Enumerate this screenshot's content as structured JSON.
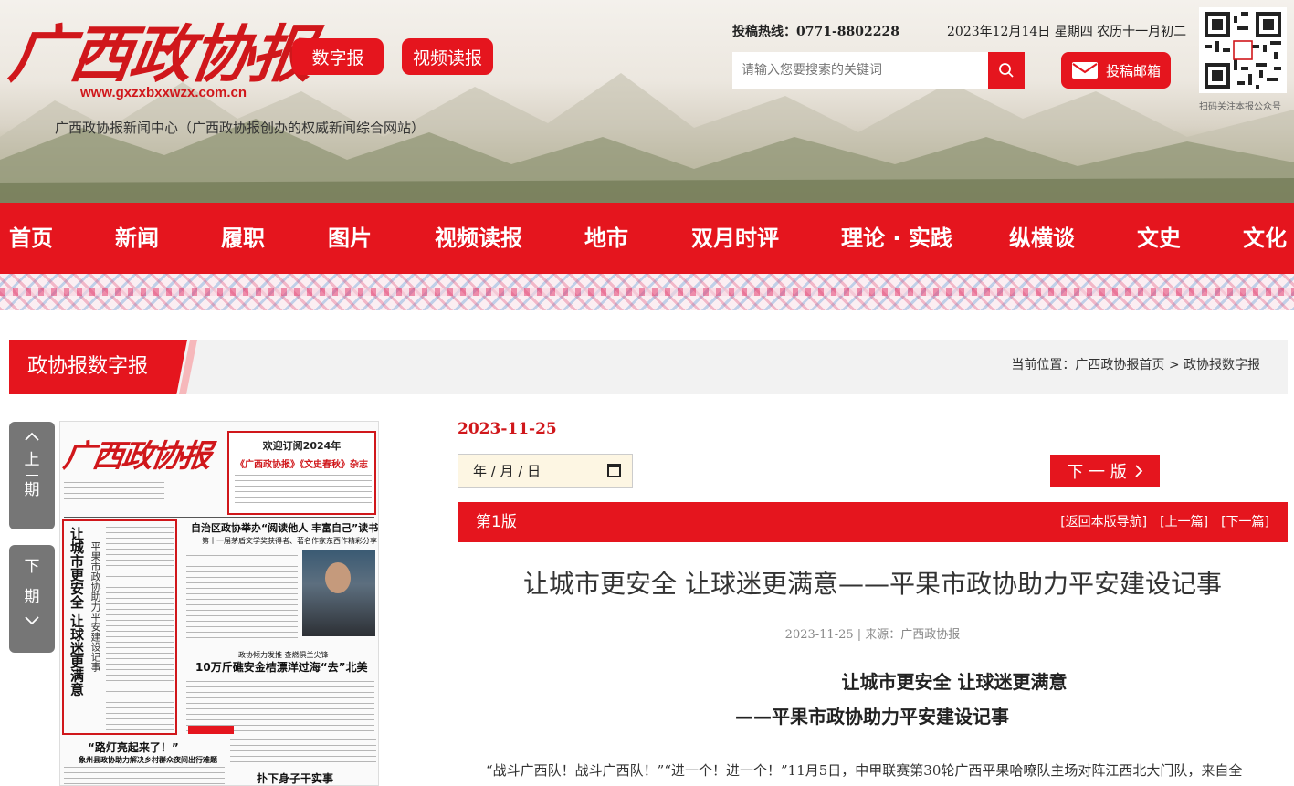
{
  "header": {
    "logo_text": "广西政协报",
    "logo_url": "www.gxzxbxxwzx.com.cn",
    "tagline": "广西政协报新闻中心（广西政协报创办的权威新闻综合网站）",
    "digital_paper_label": "数字报",
    "video_read_label": "视频读报",
    "hotline": "投稿热线：0771-8802228",
    "date_line": "2023年12月14日 星期四 农历十一月初二",
    "search_placeholder": "请输入您要搜索的关键词",
    "mail_label": "投稿邮箱",
    "qr_caption": "扫码关注本报公众号"
  },
  "nav": {
    "items": [
      {
        "label": "首页"
      },
      {
        "label": "新闻"
      },
      {
        "label": "履职"
      },
      {
        "label": "图片"
      },
      {
        "label": "视频读报"
      },
      {
        "label": "地市"
      },
      {
        "label": "双月时评"
      },
      {
        "label": "理论 · 实践"
      },
      {
        "label": "纵横谈"
      },
      {
        "label": "文史"
      },
      {
        "label": "文化"
      }
    ]
  },
  "section": {
    "title": "政协报数字报",
    "breadcrumb_prefix": "当前位置：",
    "breadcrumb_home": "广西政协报首页",
    "breadcrumb_sep": ">",
    "breadcrumb_current": "政协报数字报"
  },
  "pager": {
    "prev": [
      "上",
      "期"
    ],
    "next": [
      "下",
      "期"
    ]
  },
  "paper": {
    "logo": "广西政协报",
    "ad_line1": "欢迎订阅2024年",
    "ad_line2": "《广西政协报》《文史春秋》杂志",
    "lead_title": "让城市更安全 让球迷更满意",
    "lead_sub": "平果市政协助力平安建设记事",
    "headline1": "自治区政协举办“阅读他人 丰富自己”读书分享会",
    "headline1_sub": "第十一届茅盾文学奖获得者、著名作家东西作精彩分享",
    "headline2_kicker": "政协倾力发推 查燃俱兰尖锋",
    "headline2": "10万斤礁安金桔漂洋过海“去”北美",
    "headline3": "“路灯亮起来了！”",
    "headline3_sub": "象州县政协助力解决乡村群众夜间出行难题",
    "headline4": "扑下身子干实事"
  },
  "edition": {
    "date": "2023-11-25",
    "date_input_text": "年 / 月 / 日",
    "next_label": "下 一 版",
    "version": "第1版",
    "links": [
      "[返回本版导航]",
      "[上一篇]",
      "[下一篇]"
    ]
  },
  "article": {
    "title": "让城市更安全 让球迷更满意——平果市政协助力平安建设记事",
    "meta_date": "2023-11-25",
    "meta_sep": "|",
    "meta_source": "来源：广西政协报",
    "heading": "让城市更安全 让球迷更满意",
    "subheading": "——平果市政协助力平安建设记事",
    "body": "“战斗广西队！战斗广西队！”“进一个！进一个！”11月5日，中甲联赛第30轮广西平果哈嘹队主场对阵江西北大门队，来自全"
  },
  "colors": {
    "brand_red": "#e5151e",
    "logo_red": "#d0171b",
    "pager_gray": "#767676"
  }
}
